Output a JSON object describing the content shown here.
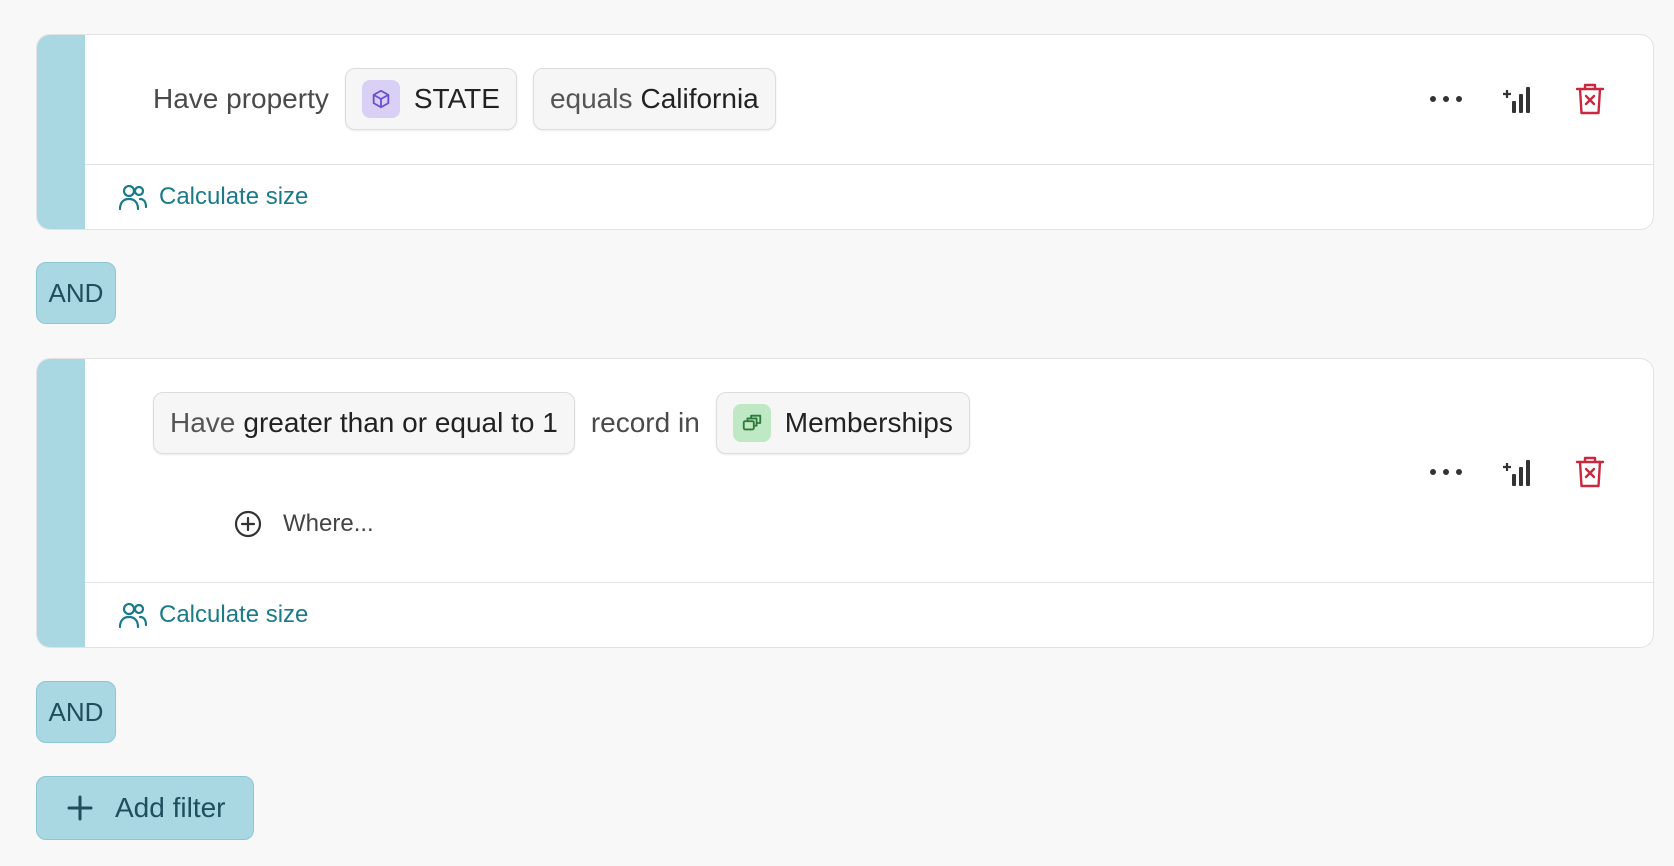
{
  "filters": [
    {
      "prefix": "Have property",
      "property_chip": {
        "label": "STATE",
        "icon": "cube-icon",
        "icon_bg": "#d8d0f5",
        "icon_color": "#6b4fd1"
      },
      "condition_chip": {
        "operator": "equals",
        "value": "California"
      },
      "calculate_label": "Calculate size"
    },
    {
      "count_chip": {
        "prefix": "Have",
        "condition": "greater than or equal to 1"
      },
      "middle_text": "record in",
      "collection_chip": {
        "label": "Memberships",
        "icon": "stacked-cards-icon",
        "icon_bg": "#bfe8c4",
        "icon_color": "#2d7a3a"
      },
      "where_label": "Where...",
      "calculate_label": "Calculate size"
    }
  ],
  "connectors": [
    "AND",
    "AND"
  ],
  "add_filter_label": "Add filter",
  "colors": {
    "accent": "#a9d8e3",
    "link": "#1a7a8a",
    "delete": "#c8293f"
  }
}
